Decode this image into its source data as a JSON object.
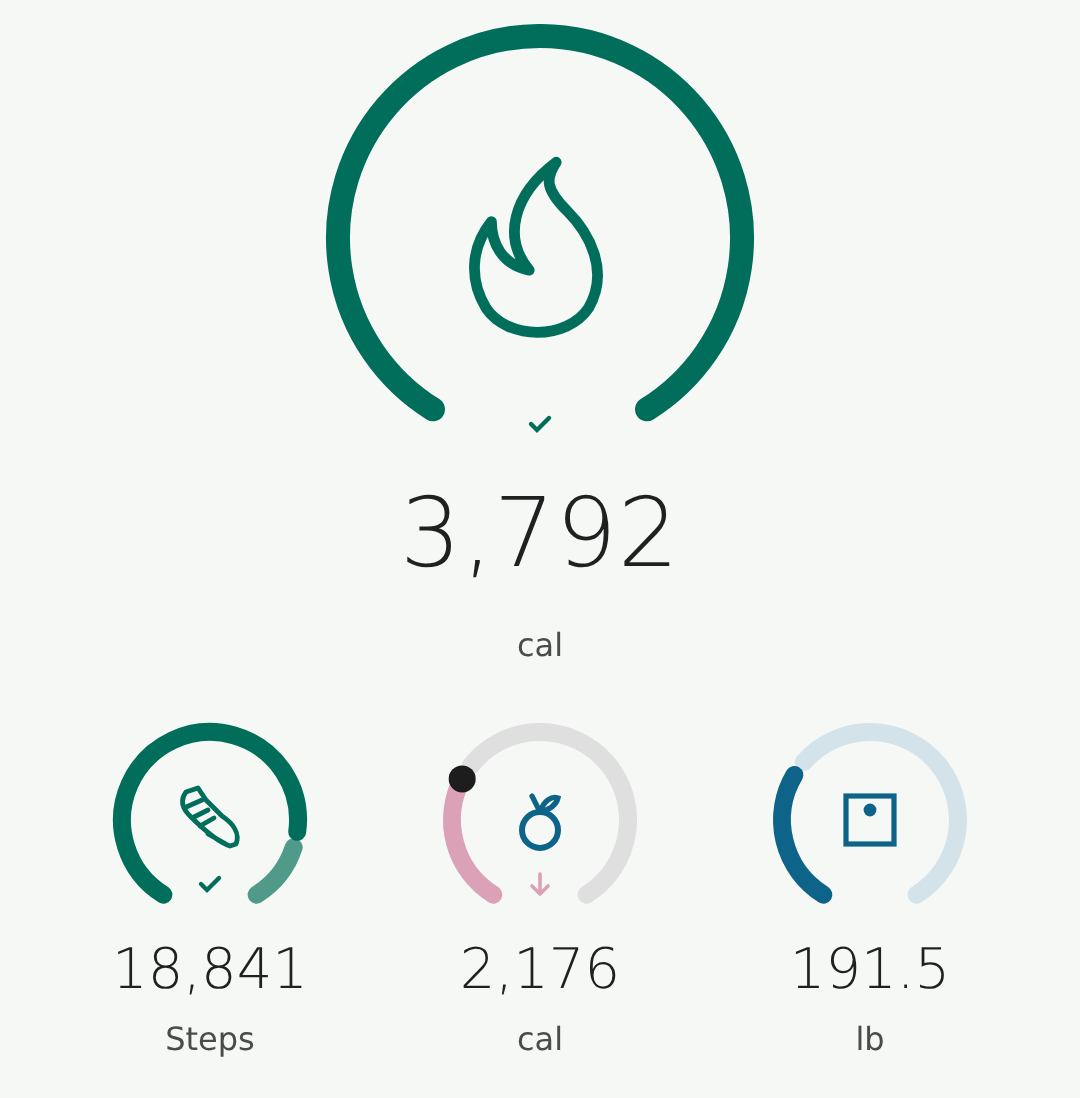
{
  "main": {
    "value": "3,792",
    "unit": "cal",
    "color": "#006e5a"
  },
  "tiles": [
    {
      "value": "18,841",
      "unit": "Steps",
      "color": "#006e5a"
    },
    {
      "value": "2,176",
      "unit": "cal",
      "color": "#dba1b7"
    },
    {
      "value": "191.5",
      "unit": "lb",
      "color": "#0d6488"
    }
  ]
}
